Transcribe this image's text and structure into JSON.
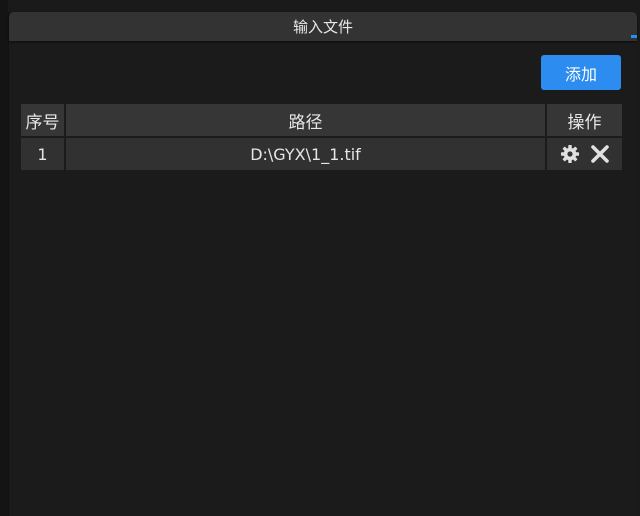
{
  "dialog": {
    "title": "输入文件",
    "add_button_label": "添加",
    "accent_color": "#2d8cf0"
  },
  "table": {
    "columns": [
      "序号",
      "路径",
      "操作"
    ],
    "rows": [
      {
        "index": "1",
        "path": "D:\\GYX\\1_1.tif",
        "actions": [
          "gear-icon",
          "close-icon"
        ]
      }
    ]
  }
}
